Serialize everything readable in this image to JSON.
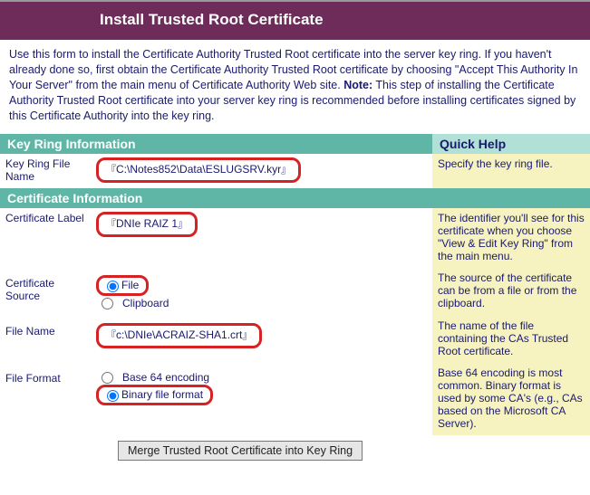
{
  "header": {
    "title": "Install Trusted Root Certificate"
  },
  "intro": {
    "part1": "Use this form to install the Certificate Authority Trusted Root certificate into the server key ring.  If you haven't already done so, first obtain the Certificate Authority Trusted Root certificate by choosing \"Accept This Authority In Your Server\" from the main menu of Certificate Authority Web site.  ",
    "note_label": "Note:",
    "part2": " This step of installing the Certificate Authority Trusted Root certificate into your server key ring is recommended before installing certificates signed by this Certificate Authority into the key ring."
  },
  "sections": {
    "keyring_title": "Key Ring Information",
    "quickhelp_title": "Quick Help",
    "certinfo_title": "Certificate Information"
  },
  "keyring": {
    "label": "Key Ring File Name",
    "value": "C:\\Notes852\\Data\\ESLUGSRV.kyr",
    "help": "Specify the key ring file."
  },
  "cert": {
    "label_label": "Certificate Label",
    "label_value": "DNIe RAIZ 1",
    "label_help": "The identifier you'll see for this certificate when you choose \"View & Edit Key Ring\" from the main menu.",
    "source_label": "Certificate Source",
    "source_options": {
      "file": "File",
      "clipboard": "Clipboard"
    },
    "source_selected": "file",
    "source_help": "The source of the certificate can be from a file or from the clipboard.",
    "filename_label": "File Name",
    "filename_value": "c:\\DNIe\\ACRAIZ-SHA1.crt",
    "filename_help": "The name of the file containing the CAs Trusted Root certificate.",
    "format_label": "File Format",
    "format_options": {
      "base64": "Base 64 encoding",
      "binary": "Binary file format"
    },
    "format_selected": "binary",
    "format_help": "Base 64 encoding is most common.  Binary format is used by some CA's (e.g., CAs based on the Microsoft CA Server)."
  },
  "buttons": {
    "merge": "Merge Trusted Root Certificate into Key Ring"
  },
  "markers": {
    "open": "『",
    "close": "』"
  }
}
